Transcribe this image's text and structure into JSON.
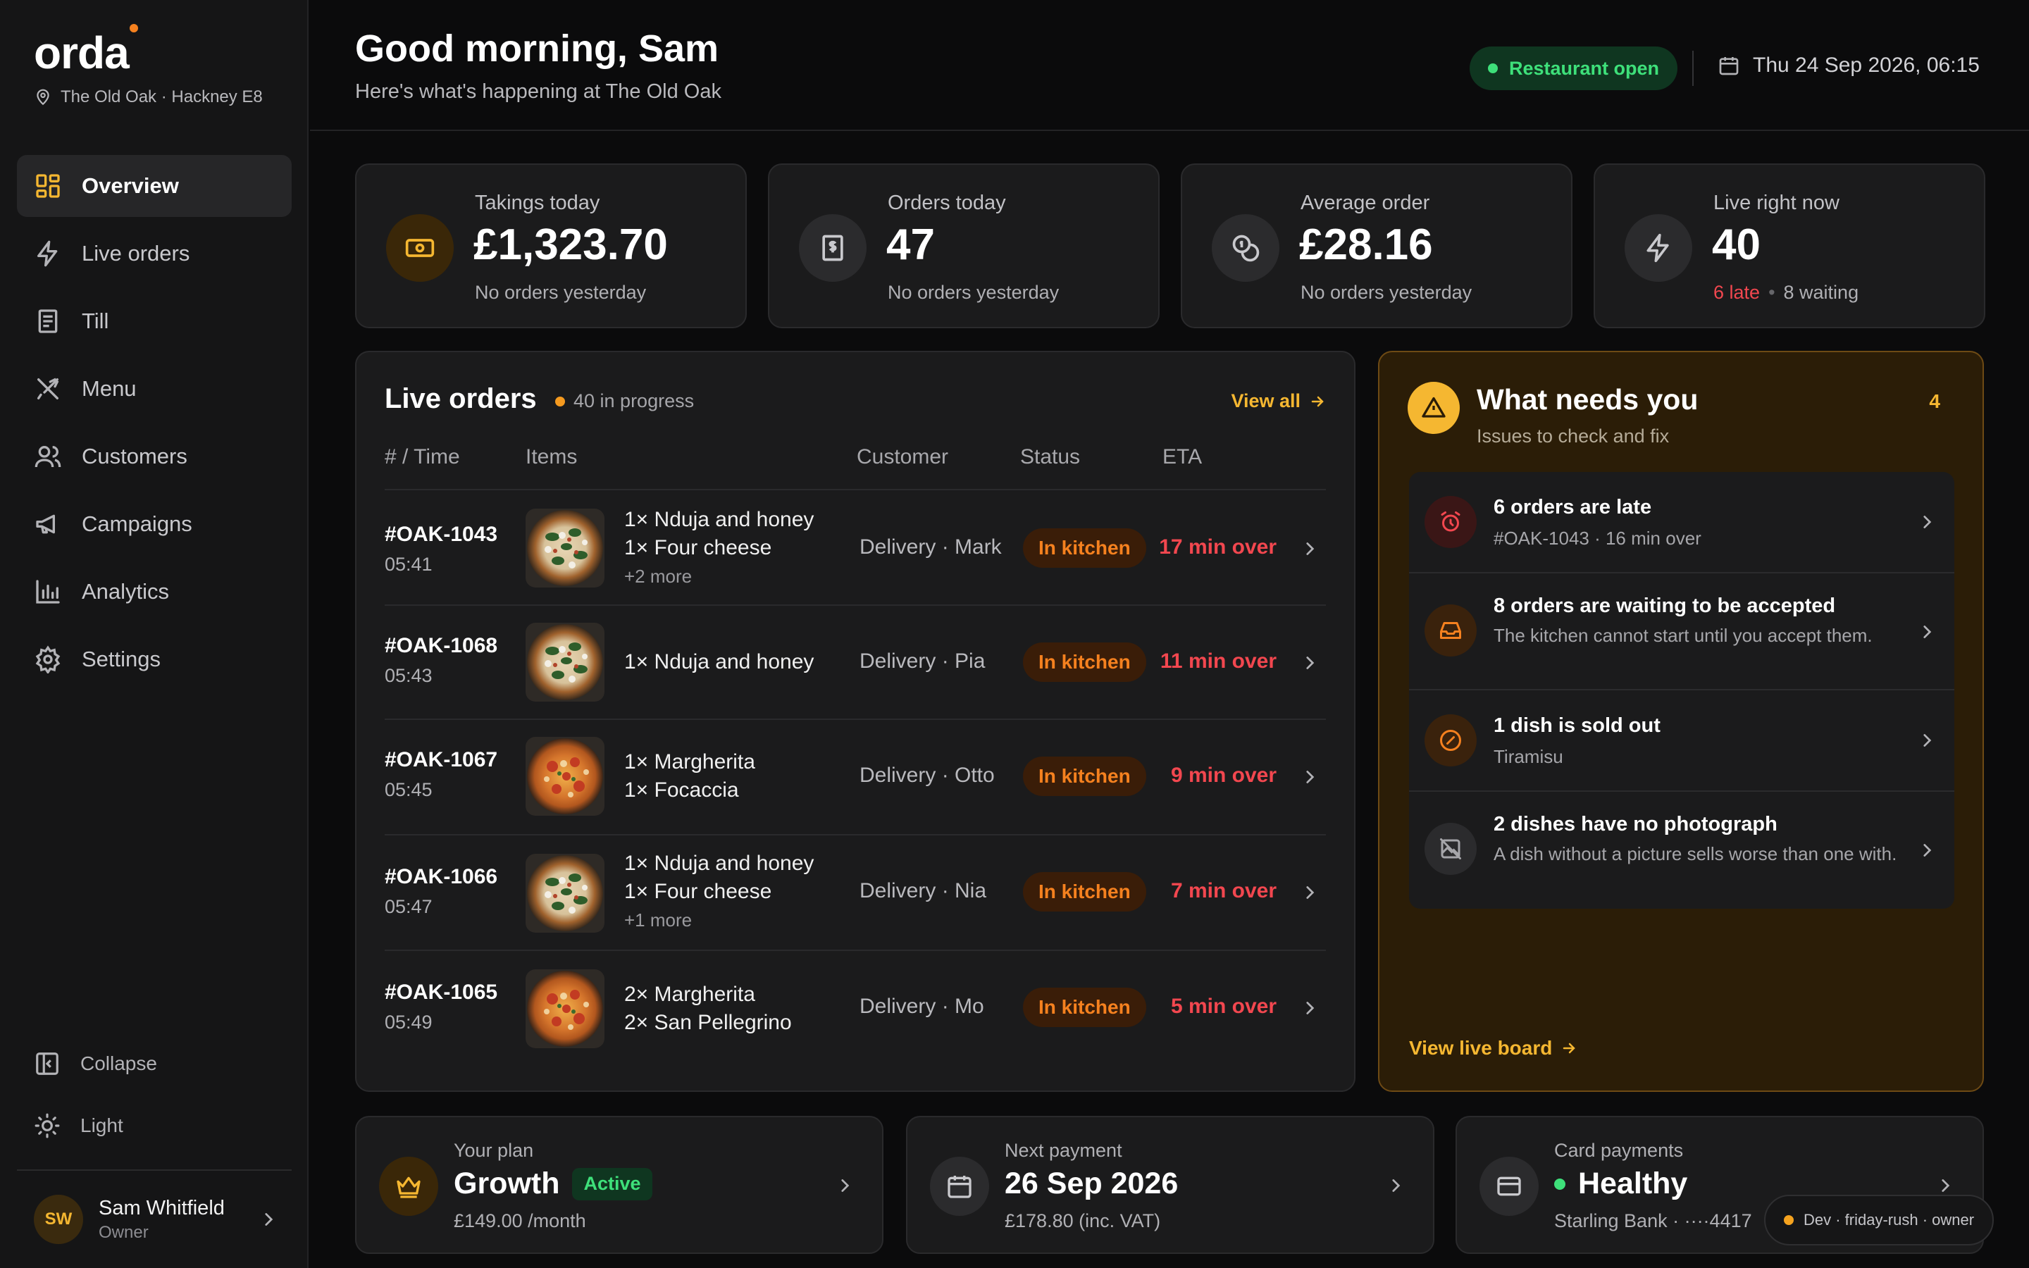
{
  "brand": {
    "name": "orda",
    "location": "The Old Oak · Hackney E8"
  },
  "nav": [
    {
      "label": "Overview",
      "icon": "grid-icon",
      "active": true
    },
    {
      "label": "Live orders",
      "icon": "bolt-icon"
    },
    {
      "label": "Till",
      "icon": "receipt-icon"
    },
    {
      "label": "Menu",
      "icon": "utensils-icon"
    },
    {
      "label": "Customers",
      "icon": "users-icon"
    },
    {
      "label": "Campaigns",
      "icon": "megaphone-icon"
    },
    {
      "label": "Analytics",
      "icon": "bar-chart-icon"
    },
    {
      "label": "Settings",
      "icon": "gear-icon"
    }
  ],
  "sidebar_bottom": {
    "collapse_label": "Collapse",
    "theme_label": "Light"
  },
  "user": {
    "initials": "SW",
    "name": "Sam Whitfield",
    "role": "Owner"
  },
  "header": {
    "greeting": "Good morning, Sam",
    "subtitle": "Here's what's happening at The Old Oak",
    "status": "Restaurant open",
    "datetime": "Thu 24 Sep 2026, 06:15"
  },
  "stats": [
    {
      "label": "Takings today",
      "value": "£1,323.70",
      "note": "No orders yesterday",
      "icon": "cash-icon"
    },
    {
      "label": "Orders today",
      "value": "47",
      "note": "No orders yesterday",
      "icon": "receipt-dollar-icon"
    },
    {
      "label": "Average order",
      "value": "£28.16",
      "note": "No orders yesterday",
      "icon": "coins-icon"
    },
    {
      "label": "Live right now",
      "value": "40",
      "late": "6 late",
      "waiting": "8 waiting",
      "icon": "bolt-icon"
    }
  ],
  "orders": {
    "title": "Live orders",
    "badge": "40 in progress",
    "view_all": "View all",
    "columns": [
      "# / Time",
      "Items",
      "Customer",
      "Status",
      "ETA"
    ],
    "rows": [
      {
        "id": "#OAK-1043",
        "time": "05:41",
        "items": [
          "1× Nduja and honey",
          "1× Four cheese"
        ],
        "more": "+2 more",
        "customer": "Delivery · Mark",
        "status": "In kitchen",
        "eta": "17 min over",
        "thumb": "green"
      },
      {
        "id": "#OAK-1068",
        "time": "05:43",
        "items": [
          "1× Nduja and honey"
        ],
        "more": "",
        "customer": "Delivery · Pia",
        "status": "In kitchen",
        "eta": "11 min over",
        "thumb": "green"
      },
      {
        "id": "#OAK-1067",
        "time": "05:45",
        "items": [
          "1× Margherita",
          "1× Focaccia"
        ],
        "more": "",
        "customer": "Delivery · Otto",
        "status": "In kitchen",
        "eta": "9 min over",
        "thumb": "red"
      },
      {
        "id": "#OAK-1066",
        "time": "05:47",
        "items": [
          "1× Nduja and honey",
          "1× Four cheese"
        ],
        "more": "+1 more",
        "customer": "Delivery · Nia",
        "status": "In kitchen",
        "eta": "7 min over",
        "thumb": "green"
      },
      {
        "id": "#OAK-1065",
        "time": "05:49",
        "items": [
          "2× Margherita",
          "2× San Pellegrino"
        ],
        "more": "",
        "customer": "Delivery · Mo",
        "status": "In kitchen",
        "eta": "5 min over",
        "thumb": "red"
      }
    ]
  },
  "needs": {
    "title": "What needs you",
    "subtitle": "Issues to check and fix",
    "count": "4",
    "issues": [
      {
        "title": "6 orders are late",
        "desc": "#OAK-1043 · 16 min over",
        "icon": "alarm-icon"
      },
      {
        "title": "8 orders are waiting to be accepted",
        "desc": "The kitchen cannot start until you accept them.",
        "icon": "inbox-icon"
      },
      {
        "title": "1 dish is sold out",
        "desc": "Tiramisu",
        "icon": "prohibited-icon"
      },
      {
        "title": "2 dishes have no photograph",
        "desc": "A dish without a picture sells worse than one with.",
        "icon": "no-photo-icon"
      }
    ],
    "view_board": "View live board"
  },
  "bottom": {
    "plan": {
      "label": "Your plan",
      "value": "Growth",
      "badge": "Active",
      "note": "£149.00 /month"
    },
    "payment": {
      "label": "Next payment",
      "value": "26 Sep 2026",
      "note": "£178.80 (inc. VAT)"
    },
    "card": {
      "label": "Card payments",
      "value": "Healthy",
      "note": "Starling Bank · ····4417"
    }
  },
  "dev_badge": "Dev · friday-rush · owner",
  "colors": {
    "accent": "#f5b731",
    "danger": "#f2474f",
    "success": "#3ee07a",
    "kitchen": "#f5811f"
  }
}
